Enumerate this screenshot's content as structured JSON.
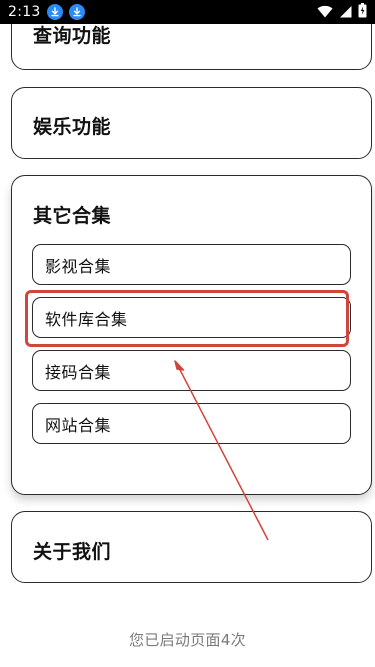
{
  "status_bar": {
    "time": "2:13",
    "icons": [
      "download-icon",
      "download-icon",
      "wifi-icon",
      "signal-icon",
      "battery-icon"
    ]
  },
  "sections": {
    "query": {
      "title": "查询功能"
    },
    "entertainment": {
      "title": "娱乐功能"
    },
    "other": {
      "title": "其它合集",
      "items": [
        {
          "label": "影视合集"
        },
        {
          "label": "软件库合集"
        },
        {
          "label": "接码合集"
        },
        {
          "label": "网站合集"
        }
      ]
    },
    "about": {
      "title": "关于我们"
    }
  },
  "footer": {
    "launch_count_text": "您已启动页面4次"
  },
  "colors": {
    "highlight": "#d0453c",
    "download_badge": "#2a8bf2",
    "footer_text": "#7b7b7b"
  }
}
